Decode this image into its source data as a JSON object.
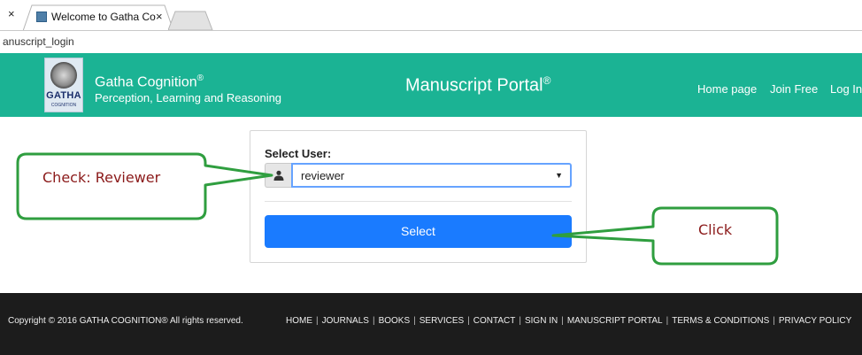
{
  "browser": {
    "window_close": "×",
    "tab_title": "Welcome to Gatha Cogn",
    "tab_close": "×",
    "url": "anuscript_login"
  },
  "header": {
    "brand_name": "Gatha Cognition",
    "brand_reg": "®",
    "brand_tagline": "Perception, Learning and Reasoning",
    "logo_text": "GATHA",
    "logo_subtext": "COGNITION",
    "portal_title": "Manuscript Portal",
    "portal_reg": "®",
    "nav": [
      "Home page",
      "Join Free",
      "Log In"
    ]
  },
  "form": {
    "select_label": "Select User:",
    "user_value": "reviewer",
    "select_button": "Select"
  },
  "callouts": {
    "check_text": "Check: Reviewer",
    "click_text": "Click"
  },
  "footer": {
    "copyright": "Copyright © 2016 GATHA COGNITION® All rights reserved.",
    "links": [
      "HOME",
      "JOURNALS",
      "BOOKS",
      "SERVICES",
      "CONTACT",
      "SIGN IN",
      "MANUSCRIPT PORTAL",
      "TERMS & CONDITIONS",
      "PRIVACY POLICY"
    ]
  },
  "colors": {
    "header_bg": "#1bb394",
    "button_bg": "#1a7bff",
    "callout_border": "#2f9e3f",
    "callout_text": "#8b1a1a",
    "footer_bg": "#1c1c1c"
  }
}
